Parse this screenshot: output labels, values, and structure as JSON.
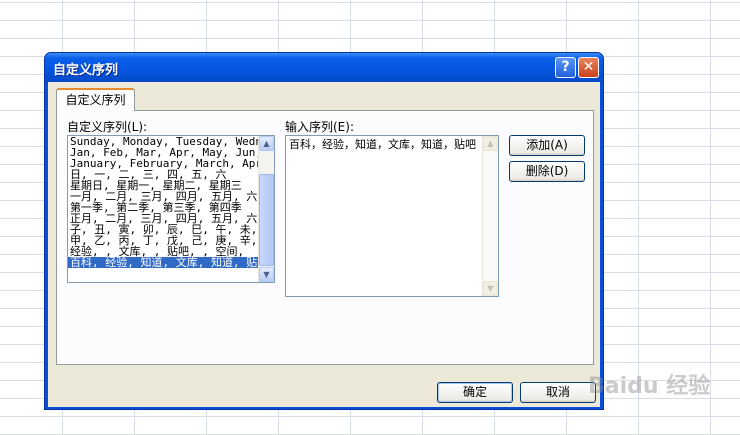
{
  "dialog": {
    "title": "自定义序列",
    "help_glyph": "?",
    "close_glyph": "✕",
    "tab_label": "自定义序列",
    "list_label": "自定义序列(L):",
    "input_label": "输入序列(E):",
    "list_items": [
      "Sunday, Monday, Tuesday, Wednesday",
      "Jan, Feb, Mar, Apr, May, Jun, Ju",
      "January, February, March, April",
      "日, 一, 二, 三, 四, 五, 六",
      "星期日, 星期一, 星期二, 星期三",
      "一月, 二月, 三月, 四月, 五月, 六",
      "第一季, 第二季, 第三季, 第四季",
      "正月, 二月, 三月, 四月, 五月, 六",
      "子, 丑, 寅, 卯, 辰, 巳, 午, 未,",
      "甲, 乙, 丙, 丁, 戊, 己, 庚, 辛,",
      "经验, , 文库, , 贴吧, , 空间,",
      "百科, 经验, 知道, 文库, 知道, 贴"
    ],
    "selected_index": 11,
    "input_value": "百科，经验，知道，文库，知道，贴吧",
    "buttons": {
      "add": "添加(A)",
      "delete": "删除(D)",
      "ok": "确定",
      "cancel": "取消"
    }
  },
  "watermark": "Baidu 经验",
  "colors": {
    "titlebar": "#0a5fe8",
    "selection": "#316ac5",
    "dialog_bg": "#ece9d8"
  }
}
